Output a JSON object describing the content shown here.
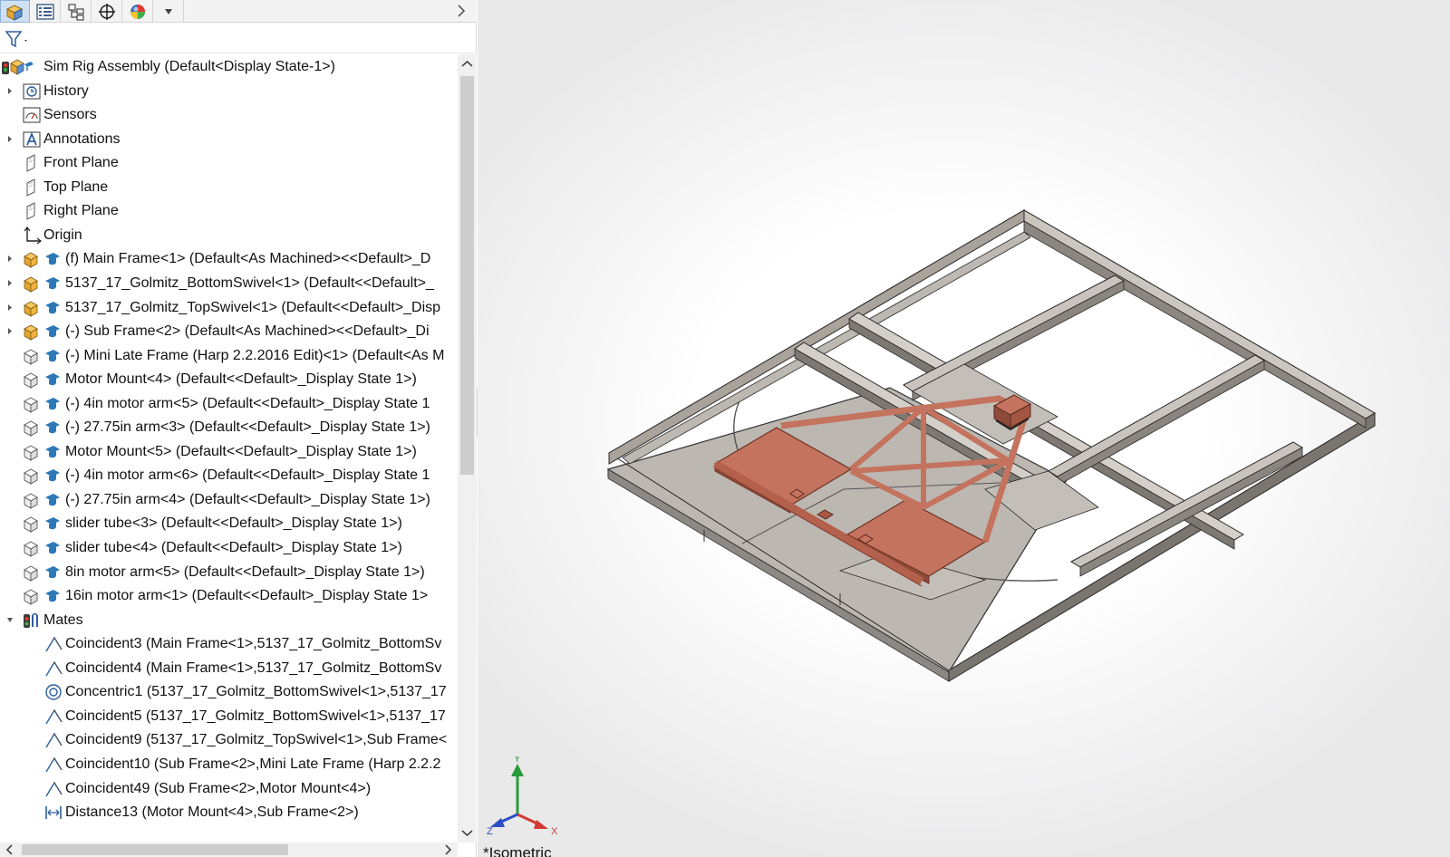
{
  "tabs": [
    {
      "name": "FeatureManager Design Tree",
      "icon": "assembly-cube-icon"
    },
    {
      "name": "PropertyManager",
      "icon": "property-list-icon"
    },
    {
      "name": "ConfigurationManager",
      "icon": "configuration-icon"
    },
    {
      "name": "DimXpertManager",
      "icon": "crosshair-icon"
    },
    {
      "name": "DisplayManager",
      "icon": "color-sphere-icon"
    },
    {
      "name": "More",
      "icon": "small-triangle-down-icon"
    }
  ],
  "tree": [
    {
      "label": "Sim Rig Assembly  (Default<Display State-1>)",
      "icon": "assembly-root-icon",
      "level": 0,
      "expander": "none"
    },
    {
      "label": "History",
      "icon": "history-icon",
      "level": 1,
      "expander": "collapsed"
    },
    {
      "label": "Sensors",
      "icon": "sensors-icon",
      "level": 1,
      "expander": "none"
    },
    {
      "label": "Annotations",
      "icon": "annotations-icon",
      "level": 1,
      "expander": "collapsed"
    },
    {
      "label": "Front Plane",
      "icon": "plane-icon",
      "level": 1,
      "expander": "none"
    },
    {
      "label": "Top Plane",
      "icon": "plane-icon",
      "level": 1,
      "expander": "none"
    },
    {
      "label": "Right Plane",
      "icon": "plane-icon",
      "level": 1,
      "expander": "none"
    },
    {
      "label": "Origin",
      "icon": "origin-icon",
      "level": 1,
      "expander": "none"
    },
    {
      "label": "(f) Main Frame<1> (Default<As Machined><<Default>_D",
      "icon": "subassembly-icon",
      "level": 1,
      "expander": "collapsed"
    },
    {
      "label": "5137_17_Golmitz_BottomSwivel<1> (Default<<Default>_",
      "icon": "subassembly-icon",
      "level": 1,
      "expander": "collapsed"
    },
    {
      "label": "5137_17_Golmitz_TopSwivel<1> (Default<<Default>_Disp",
      "icon": "subassembly-icon",
      "level": 1,
      "expander": "collapsed"
    },
    {
      "label": "(-) Sub Frame<2> (Default<As Machined><<Default>_Di",
      "icon": "subassembly-icon",
      "level": 1,
      "expander": "collapsed"
    },
    {
      "label": "(-) Mini Late Frame (Harp 2.2.2016 Edit)<1> (Default<As M",
      "icon": "part-icon",
      "level": 1,
      "expander": "none"
    },
    {
      "label": "Motor Mount<4> (Default<<Default>_Display State 1>)",
      "icon": "part-icon",
      "level": 1,
      "expander": "none"
    },
    {
      "label": "(-) 4in motor arm<5> (Default<<Default>_Display State 1",
      "icon": "part-icon",
      "level": 1,
      "expander": "none"
    },
    {
      "label": "(-) 27.75in arm<3> (Default<<Default>_Display State 1>)",
      "icon": "part-icon",
      "level": 1,
      "expander": "none"
    },
    {
      "label": "Motor Mount<5> (Default<<Default>_Display State 1>)",
      "icon": "part-icon",
      "level": 1,
      "expander": "none"
    },
    {
      "label": "(-) 4in motor arm<6> (Default<<Default>_Display State 1",
      "icon": "part-icon",
      "level": 1,
      "expander": "none"
    },
    {
      "label": "(-) 27.75in arm<4> (Default<<Default>_Display State 1>)",
      "icon": "part-icon",
      "level": 1,
      "expander": "none"
    },
    {
      "label": "slider tube<3> (Default<<Default>_Display State 1>)",
      "icon": "part-icon",
      "level": 1,
      "expander": "none"
    },
    {
      "label": "slider tube<4> (Default<<Default>_Display State 1>)",
      "icon": "part-icon",
      "level": 1,
      "expander": "none"
    },
    {
      "label": "8in motor arm<5> (Default<<Default>_Display State 1>)",
      "icon": "part-icon",
      "level": 1,
      "expander": "none"
    },
    {
      "label": "16in motor arm<1> (Default<<Default>_Display State 1>",
      "icon": "part-icon",
      "level": 1,
      "expander": "none"
    },
    {
      "label": "Mates",
      "icon": "mates-icon",
      "level": 1,
      "expander": "expanded"
    },
    {
      "label": "Coincident3 (Main Frame<1>,5137_17_Golmitz_BottomSv",
      "icon": "coincident-mate-icon",
      "level": 2,
      "expander": "none"
    },
    {
      "label": "Coincident4 (Main Frame<1>,5137_17_Golmitz_BottomSv",
      "icon": "coincident-mate-icon",
      "level": 2,
      "expander": "none"
    },
    {
      "label": "Concentric1 (5137_17_Golmitz_BottomSwivel<1>,5137_17",
      "icon": "concentric-mate-icon",
      "level": 2,
      "expander": "none"
    },
    {
      "label": "Coincident5 (5137_17_Golmitz_BottomSwivel<1>,5137_17",
      "icon": "coincident-mate-icon",
      "level": 2,
      "expander": "none"
    },
    {
      "label": "Coincident9 (5137_17_Golmitz_TopSwivel<1>,Sub Frame<",
      "icon": "coincident-mate-icon",
      "level": 2,
      "expander": "none"
    },
    {
      "label": "Coincident10 (Sub Frame<2>,Mini Late Frame (Harp 2.2.2",
      "icon": "coincident-mate-icon",
      "level": 2,
      "expander": "none"
    },
    {
      "label": "Coincident49 (Sub Frame<2>,Motor Mount<4>)",
      "icon": "coincident-mate-icon",
      "level": 2,
      "expander": "none"
    },
    {
      "label": "Distance13 (Motor Mount<4>,Sub Frame<2>)",
      "icon": "distance-mate-icon",
      "level": 2,
      "expander": "none"
    }
  ],
  "graphics": {
    "view_label": "*Isometric",
    "triad": {
      "x": "X",
      "y": "Y",
      "z": "Z"
    }
  },
  "colors": {
    "frame_gray": "#b9b4ae",
    "frame_edge": "#3a3a3a",
    "copper": "#c4735e",
    "copper_dark": "#8f4a39",
    "selection_blue": "#cfe0f2"
  }
}
